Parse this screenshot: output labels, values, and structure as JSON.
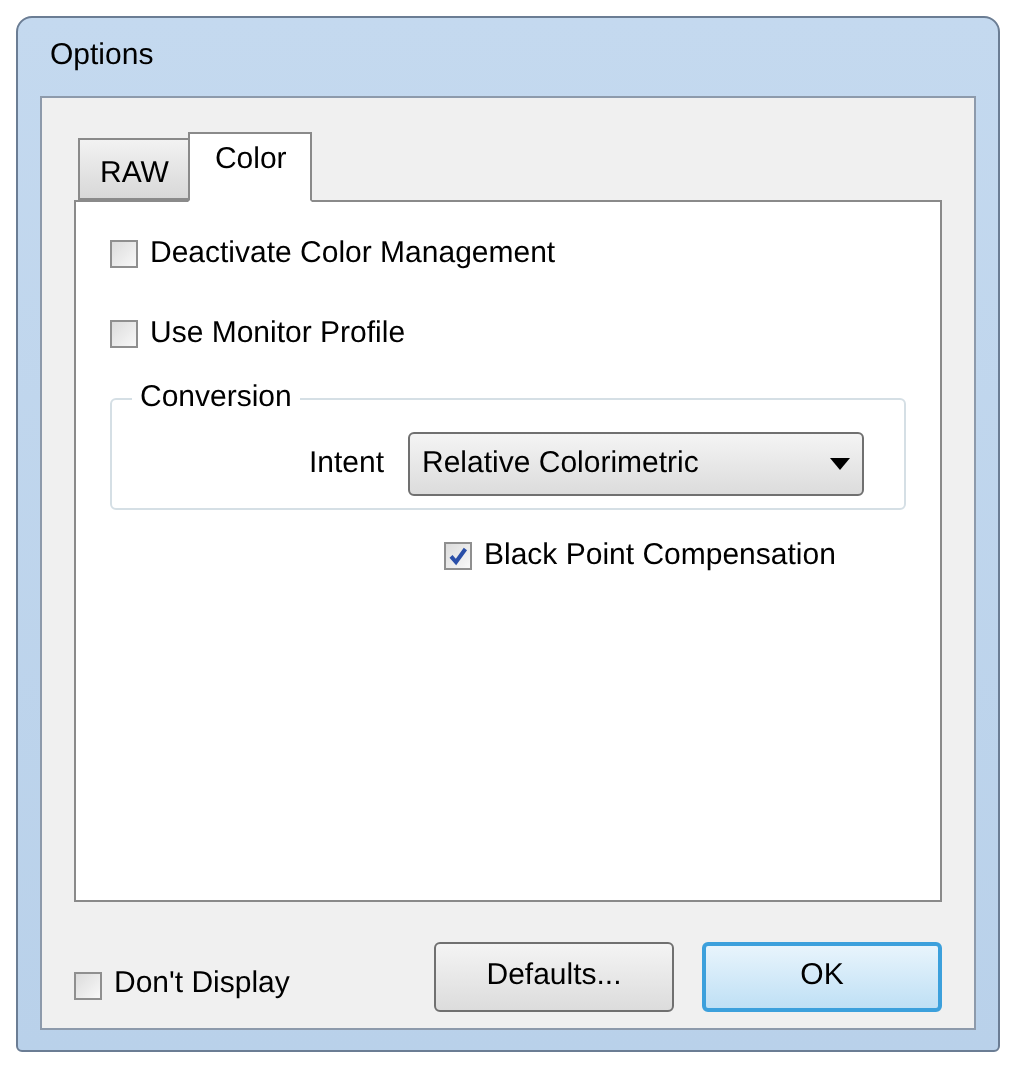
{
  "window": {
    "title": "Options"
  },
  "tabs": [
    {
      "label": "RAW",
      "selected": false
    },
    {
      "label": "Color",
      "selected": true
    }
  ],
  "options": [
    {
      "label": "Deactivate Color Management",
      "checked": false
    },
    {
      "label": "Use Monitor Profile",
      "checked": false
    }
  ],
  "conversion": {
    "title": "Conversion",
    "intent_label": "Intent",
    "intent_value": "Relative Colorimetric"
  },
  "black_point": {
    "label": "Black Point Compensation",
    "checked": true
  },
  "dont_display": {
    "label": "Don't Display",
    "checked": false
  },
  "buttons": [
    {
      "label": "Defaults...",
      "kind": "normal"
    },
    {
      "label": "OK",
      "kind": "default"
    }
  ]
}
